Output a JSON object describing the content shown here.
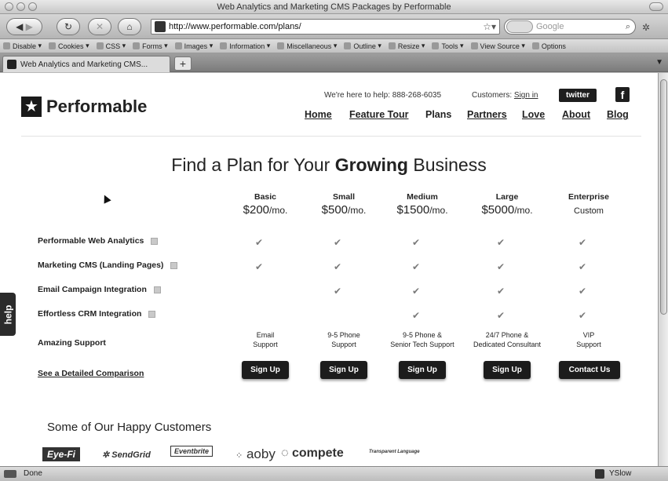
{
  "window": {
    "title": "Web Analytics and Marketing CMS Packages by Performable"
  },
  "toolbar": {
    "url": "http://www.performable.com/plans/",
    "search_placeholder": "Google",
    "back_icon": "back-arrow-icon",
    "forward_icon": "forward-arrow-icon",
    "reload_icon": "reload-icon",
    "stop_icon": "stop-icon",
    "home_icon": "home-icon"
  },
  "devbar": {
    "items": [
      "Disable",
      "Cookies",
      "CSS",
      "Forms",
      "Images",
      "Information",
      "Miscellaneous",
      "Outline",
      "Resize",
      "Tools",
      "View Source",
      "Options"
    ]
  },
  "tabs": {
    "active_label": "Web Analytics and Marketing CMS...",
    "new_tab": "+"
  },
  "header": {
    "brand": "Performable",
    "help_text": "We're here to help: 888-268-6035",
    "customers_label": "Customers:",
    "sign_in": "Sign in",
    "twitter": "twitter",
    "facebook": "f",
    "nav": [
      "Home",
      "Feature Tour",
      "Plans",
      "Partners",
      "Love",
      "About",
      "Blog"
    ]
  },
  "headline": {
    "before": "Find a Plan for Your ",
    "bold": "Growing",
    "after": " Business"
  },
  "plans": [
    {
      "name": "Basic",
      "price": "$200",
      "per": "/mo.",
      "support": [
        "Email",
        "Support"
      ],
      "cta": "Sign Up"
    },
    {
      "name": "Small",
      "price": "$500",
      "per": "/mo.",
      "support": [
        "9-5 Phone",
        "Support"
      ],
      "cta": "Sign Up"
    },
    {
      "name": "Medium",
      "price": "$1500",
      "per": "/mo.",
      "support": [
        "9-5 Phone &",
        "Senior Tech Support"
      ],
      "cta": "Sign Up"
    },
    {
      "name": "Large",
      "price": "$5000",
      "per": "/mo.",
      "support": [
        "24/7 Phone &",
        "Dedicated Consultant"
      ],
      "cta": "Sign Up"
    },
    {
      "name": "Enterprise",
      "price": "",
      "per": "",
      "custom": "Custom",
      "support": [
        "VIP",
        "Support"
      ],
      "cta": "Contact Us"
    }
  ],
  "features": [
    {
      "label": "Performable Web Analytics",
      "checks": [
        true,
        true,
        true,
        true,
        true
      ]
    },
    {
      "label": "Marketing CMS (Landing Pages)",
      "checks": [
        true,
        true,
        true,
        true,
        true
      ]
    },
    {
      "label": "Email Campaign Integration",
      "checks": [
        false,
        true,
        true,
        true,
        true
      ]
    },
    {
      "label": "Effortless CRM Integration",
      "checks": [
        false,
        false,
        true,
        true,
        true
      ]
    }
  ],
  "support_label": "Amazing Support",
  "comparison_link": "See a Detailed Comparison",
  "customers": {
    "heading": "Some of Our Happy Customers",
    "logos": [
      "Eye-Fi",
      "SendGrid",
      "Eventbrite",
      "aoby",
      "compete",
      "Transparent Language"
    ]
  },
  "help_tab": "help",
  "status": {
    "text": "Done",
    "yslow": "YSlow"
  }
}
